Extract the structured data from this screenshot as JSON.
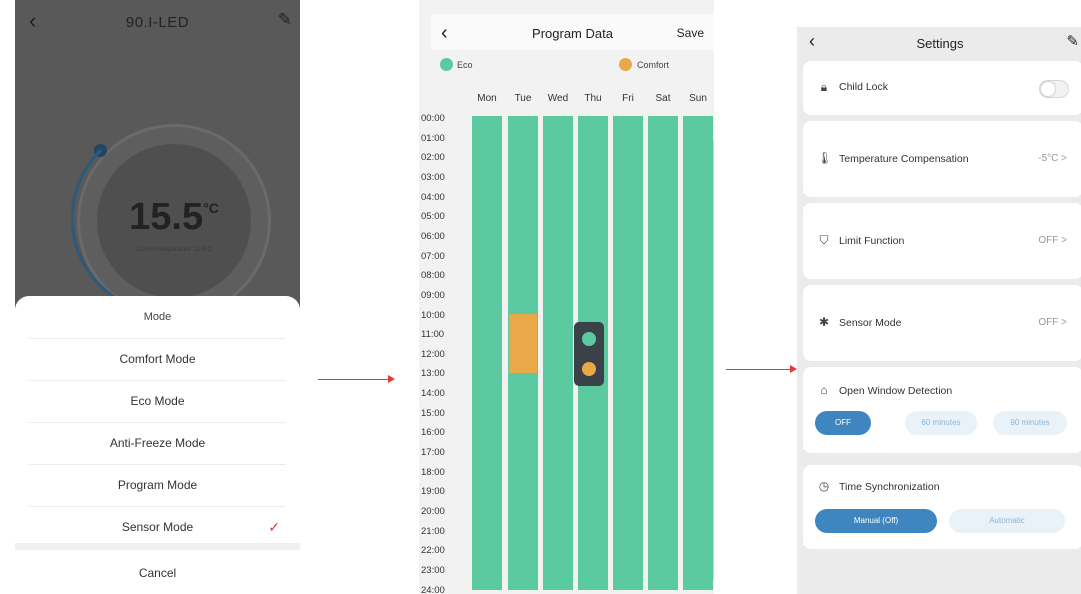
{
  "thermostat_screen": {
    "title": "90.I-LED",
    "back_icon": "chevron-left-icon",
    "edit_icon": "edit-icon",
    "temperature": "15.5",
    "temperature_unit": "°C",
    "current_temperature_text": "Current temperature: 11.8°C",
    "mode_sheet": {
      "heading": "Mode",
      "options": [
        "Comfort Mode",
        "Eco Mode",
        "Anti-Freeze Mode",
        "Program Mode",
        "Sensor Mode"
      ],
      "selected": "Sensor Mode",
      "cancel": "Cancel"
    }
  },
  "program_screen": {
    "title": "Program Data",
    "save": "Save",
    "legend": [
      {
        "label": "Eco",
        "color": "#5bcaa0"
      },
      {
        "label": "Comfort",
        "color": "#eaa948"
      }
    ],
    "days": [
      "Mon",
      "Tue",
      "Wed",
      "Thu",
      "Fri",
      "Sat",
      "Sun"
    ],
    "times": [
      "00:00",
      "01:00",
      "02:00",
      "03:00",
      "04:00",
      "05:00",
      "06:00",
      "07:00",
      "08:00",
      "09:00",
      "10:00",
      "11:00",
      "12:00",
      "13:00",
      "14:00",
      "15:00",
      "16:00",
      "17:00",
      "18:00",
      "19:00",
      "20:00",
      "21:00",
      "22:00",
      "23:00",
      "24:00"
    ],
    "comfort_blocks": [
      {
        "day": "Tue",
        "start": "10:00",
        "end": "13:00"
      }
    ]
  },
  "settings_screen": {
    "title": "Settings",
    "child_lock": {
      "label": "Child Lock",
      "enabled": false
    },
    "temperature_compensation": {
      "label": "Temperature Compensation",
      "value": "-5°C"
    },
    "limit_function": {
      "label": "Limit Function",
      "value": "OFF"
    },
    "sensor_mode": {
      "label": "Sensor Mode",
      "value": "OFF"
    },
    "open_window_detection": {
      "label": "Open Window Detection",
      "options": [
        "OFF",
        "60 minutes",
        "90 minutes"
      ],
      "selected": "OFF"
    },
    "time_synchronization": {
      "label": "Time Synchronization",
      "options": [
        "Manual (Off)",
        "Automatic"
      ],
      "selected": "Manual (Off)"
    },
    "chevron": ">"
  },
  "colors": {
    "eco": "#5bcaa0",
    "comfort": "#eaa948",
    "accent_blue": "#3f86c0",
    "arrow_red": "#e53935"
  }
}
